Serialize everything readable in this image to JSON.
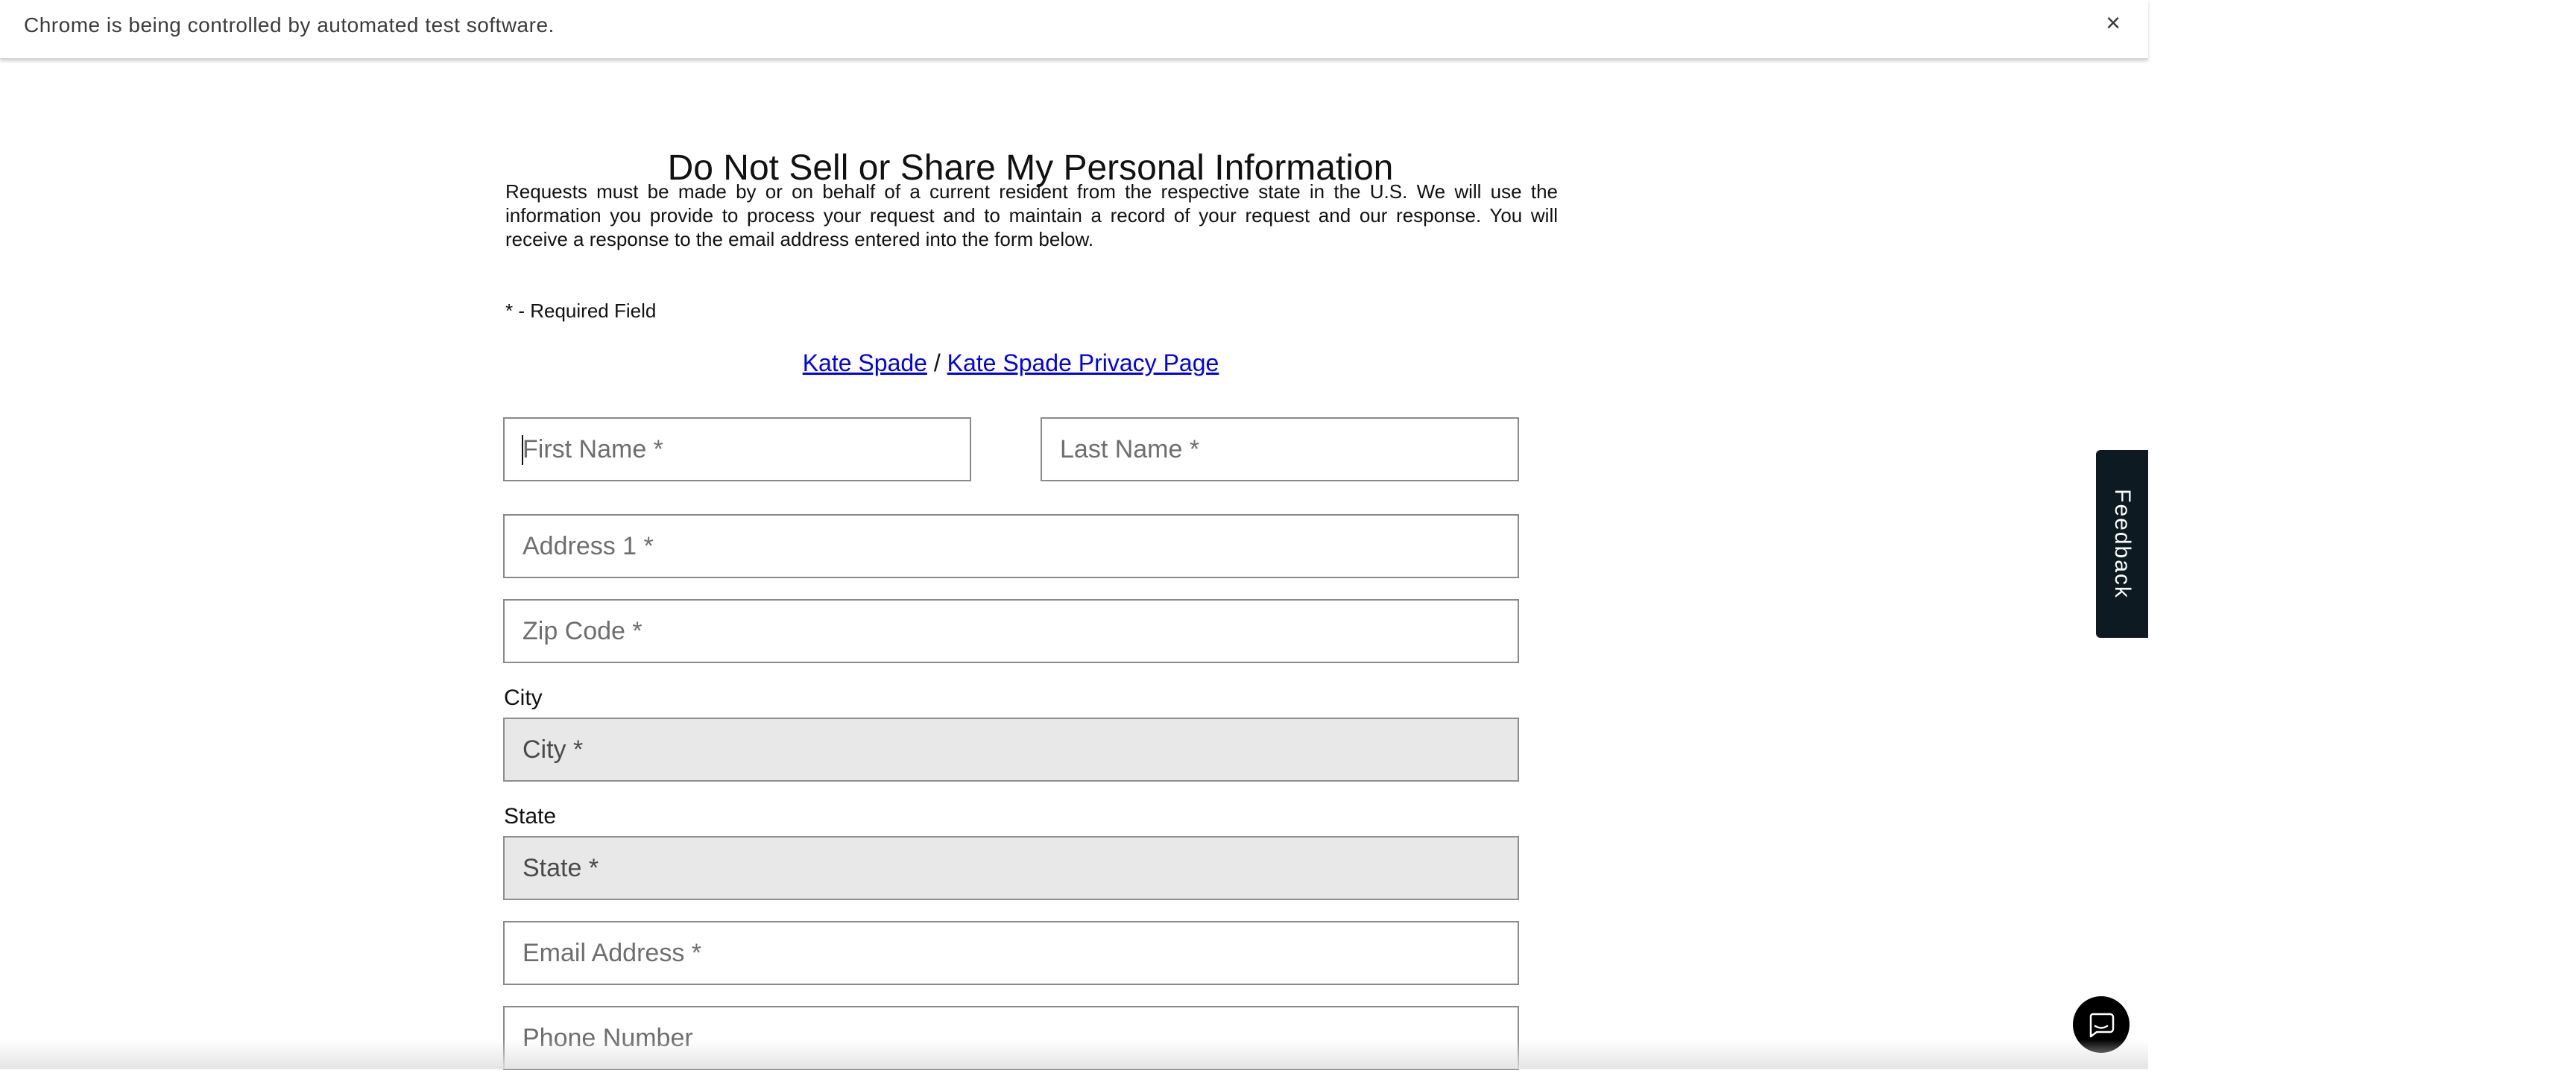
{
  "browser": {
    "infobar_text": "Chrome is being controlled by automated test software.",
    "infobar_close": "×"
  },
  "page": {
    "title": "Do Not Sell or Share My Personal Information",
    "intro": "Requests must be made by or on behalf of a current resident from the respective state in the U.S. We will use the information you provide to process your request and to maintain a record of your request and our response. You will receive a response to the email address entered into the form below.",
    "required_note": "* - Required Field",
    "links": {
      "brand": "Kate Spade",
      "separator": " / ",
      "privacy": "Kate Spade Privacy Page"
    }
  },
  "form": {
    "first_name": {
      "placeholder": "First Name *",
      "value": ""
    },
    "last_name": {
      "placeholder": "Last Name *",
      "value": ""
    },
    "address1": {
      "placeholder": "Address 1 *",
      "value": ""
    },
    "zip": {
      "placeholder": "Zip Code *",
      "value": ""
    },
    "city": {
      "label": "City",
      "placeholder": "City *",
      "value": "",
      "disabled": true
    },
    "state": {
      "label": "State",
      "placeholder": "State *",
      "value": "",
      "disabled": true
    },
    "email": {
      "placeholder": "Email Address *",
      "value": ""
    },
    "phone": {
      "placeholder": "Phone Number",
      "value": ""
    }
  },
  "widgets": {
    "feedback_label": "Feedback",
    "chat_icon": "chat-bubble-icon"
  },
  "colors": {
    "link": "#0000ee",
    "feedback_bg": "#0e1a22",
    "disabled_field_bg": "#e8e8e8"
  }
}
